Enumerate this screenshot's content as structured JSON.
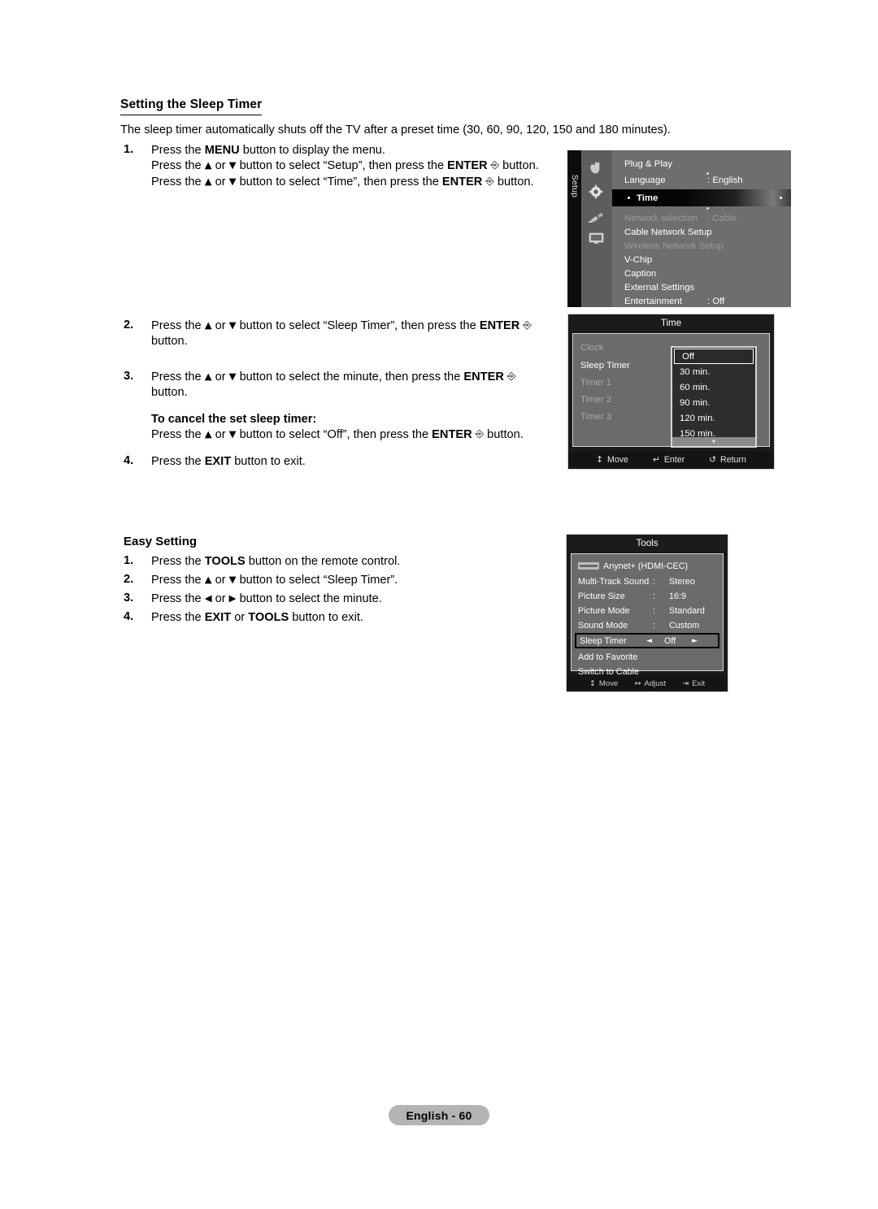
{
  "document": {
    "section_title": "Setting the Sleep Timer",
    "intro": "The sleep timer automatically shuts off the TV after a preset time (30, 60, 90, 120, 150 and 180 minutes).",
    "steps": [
      {
        "num": "1.",
        "lines": [
          "Press the MENU button to display the menu.",
          "Press the ▲ or ▼ button to select “Setup”, then press the ENTER ↵ button.",
          "Press the ▲ or ▼ button to select “Time”, then press the ENTER ↵ button."
        ]
      },
      {
        "num": "2.",
        "lines": [
          "Press the ▲ or ▼ button to select “Sleep Timer”, then press the ENTER ↵",
          "button."
        ]
      },
      {
        "num": "3.",
        "lines": [
          "Press the ▲ or ▼ button to select the minute, then press the ENTER ↵",
          "button."
        ],
        "note_title": "To cancel the set sleep timer:",
        "note_line": "Press the ▲ or ▼ button to select “Off”, then press the ENTER ↵ button."
      },
      {
        "num": "4.",
        "lines": [
          "Press the EXIT button to exit."
        ]
      }
    ],
    "easy_setting": {
      "title": "Easy Setting",
      "steps": [
        {
          "num": "1.",
          "line": "Press the TOOLS button on the remote control."
        },
        {
          "num": "2.",
          "line": "Press the ▲ or ▼ button to select “Sleep Timer”."
        },
        {
          "num": "3.",
          "line": "Press the ◄ or ► button to select the minute."
        },
        {
          "num": "4.",
          "line": "Press the EXIT or TOOLS button to exit."
        }
      ]
    },
    "footer": "English - 60"
  },
  "setup_menu": {
    "tab_label": "Setup",
    "rows": [
      {
        "label": "Plug & Play",
        "value": ""
      },
      {
        "label": "Language",
        "value": ": English"
      },
      {
        "label": "Time",
        "value": "",
        "selected": true
      },
      {
        "label": "Network selection",
        "value": ": Cable",
        "dim": true
      },
      {
        "label": "Cable Network Setup",
        "value": ""
      },
      {
        "label": "Wireless Network Setup",
        "value": "",
        "dim": true
      },
      {
        "label": "V-Chip",
        "value": ""
      },
      {
        "label": "Caption",
        "value": ""
      },
      {
        "label": "External Settings",
        "value": ""
      },
      {
        "label": "Entertainment",
        "value": ": Off"
      }
    ],
    "icons": [
      "hand-icon",
      "gear-icon",
      "plug-icon",
      "display-icon"
    ]
  },
  "time_menu": {
    "title": "Time",
    "rows": [
      {
        "label": "Clock",
        "colon": ":",
        "dim": true
      },
      {
        "label": "Sleep Timer",
        "colon": ":",
        "dim": false
      },
      {
        "label": "Timer 1",
        "colon": ":",
        "dim": true
      },
      {
        "label": "Timer 2",
        "colon": ":",
        "dim": true
      },
      {
        "label": "Timer 3",
        "colon": ":",
        "dim": true
      }
    ],
    "dropdown": {
      "selected": "Off",
      "options": [
        "Off",
        "30 min.",
        "60 min.",
        "90 min.",
        "120 min.",
        "150 min."
      ],
      "more_indicator": "▼"
    },
    "footer": [
      {
        "icon": "↕",
        "label": "Move"
      },
      {
        "icon": "↵",
        "label": "Enter"
      },
      {
        "icon": "↺",
        "label": "Return"
      }
    ]
  },
  "tools_menu": {
    "title": "Tools",
    "rows": [
      {
        "label": "Anynet+ (HDMI-CEC)",
        "colon": "",
        "value": "",
        "badge": true
      },
      {
        "label": "Multi-Track Sound",
        "colon": ":",
        "value": "Stereo"
      },
      {
        "label": "Picture Size",
        "colon": ":",
        "value": "16:9"
      },
      {
        "label": "Picture Mode",
        "colon": ":",
        "value": "Standard"
      },
      {
        "label": "Sound Mode",
        "colon": ":",
        "value": "Custom"
      },
      {
        "label": "Sleep Timer",
        "colon": "",
        "value": "Off",
        "selected": true,
        "arrow_left": "◄",
        "arrow_right": "►"
      },
      {
        "label": "Add to Favorite",
        "colon": "",
        "value": ""
      },
      {
        "label": "Switch to Cable",
        "colon": "",
        "value": ""
      }
    ],
    "footer": [
      {
        "icon": "↕",
        "label": "Move"
      },
      {
        "icon": "↔",
        "label": "Adjust"
      },
      {
        "icon": "⇥",
        "label": "Exit"
      }
    ]
  },
  "colors": {
    "osd_body": "#6b6b6b",
    "osd_frame": "#1b1b1b",
    "osd_border": "#cfcfcf",
    "footer_pill": "#b4b4b4",
    "dim_text": "#a8a8a8"
  }
}
